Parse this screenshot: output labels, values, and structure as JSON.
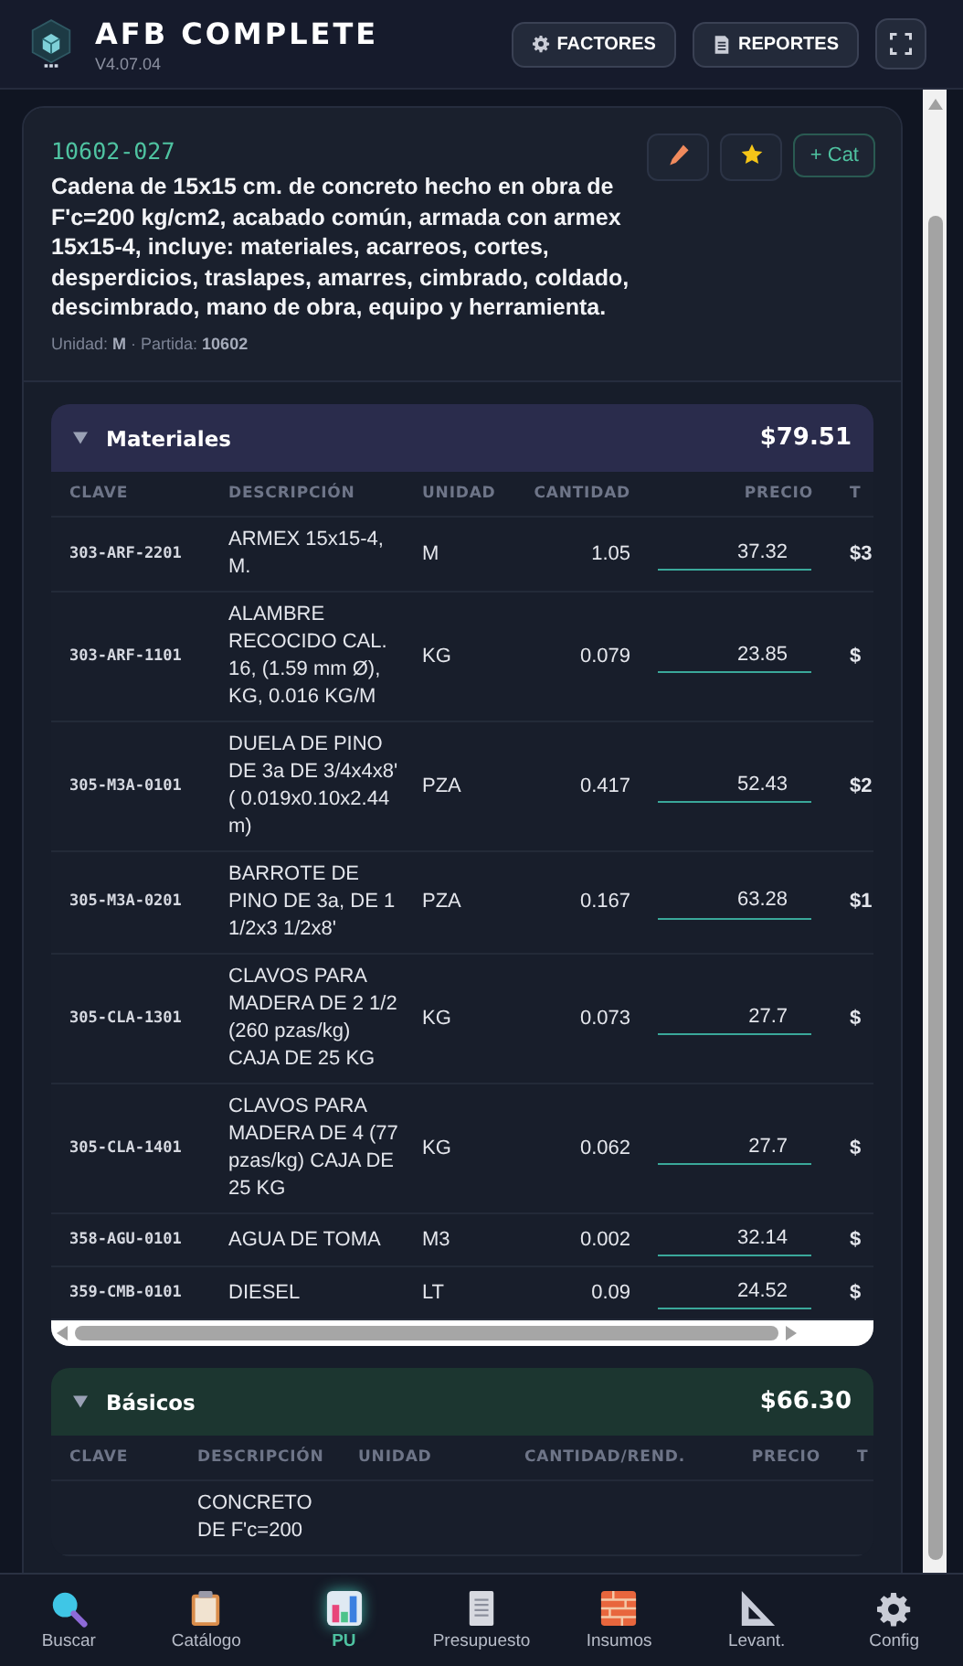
{
  "app": {
    "title": "AFB COMPLETE",
    "version": "V4.07.04"
  },
  "header_buttons": [
    {
      "kind": "gear",
      "label": "FACTORES"
    },
    {
      "kind": "doc",
      "label": "REPORTES"
    },
    {
      "kind": "fullscreen"
    }
  ],
  "item": {
    "code": "10602-027",
    "description": "Cadena de 15x15 cm. de concreto hecho en obra de F'c=200 kg/cm2, acabado común, armada con armex 15x15-4, incluye: materiales, acarreos, cortes, desperdicios, traslapes, amarres, cimbrado, coldado, descimbrado, mano de obra, equipo y herramienta.",
    "meta": "Unidad: **M** · Partida: **10602**",
    "actions": [
      {
        "kind": "edit"
      },
      {
        "kind": "favorite"
      },
      {
        "kind": "text",
        "label": "+ Cat"
      }
    ]
  },
  "sections": [
    {
      "kind": "materials",
      "title": "Materiales",
      "total": "$79.51",
      "expanded": true,
      "columns": [
        "CLAVE",
        "DESCRIPCIÓN",
        "UNIDAD",
        "CANTIDAD",
        "PRECIO",
        "T"
      ],
      "rows": [
        {
          "clave": "303-ARF-2201",
          "descripcion": "ARMEX 15x15-4, M.",
          "unidad": "M",
          "cantidad": "1.05",
          "precio": "37.32",
          "total": "$3"
        },
        {
          "clave": "303-ARF-1101",
          "descripcion": "ALAMBRE RECOCIDO CAL. 16, (1.59 mm Ø), KG, 0.016 KG/M",
          "unidad": "KG",
          "cantidad": "0.079",
          "precio": "23.85",
          "total": "$"
        },
        {
          "clave": "305-M3A-0101",
          "descripcion": "DUELA DE PINO DE 3a DE 3/4x4x8' ( 0.019x0.10x2.44 m)",
          "unidad": "PZA",
          "cantidad": "0.417",
          "precio": "52.43",
          "total": "$2"
        },
        {
          "clave": "305-M3A-0201",
          "descripcion": "BARROTE DE PINO DE 3a, DE 1 1/2x3 1/2x8'",
          "unidad": "PZA",
          "cantidad": "0.167",
          "precio": "63.28",
          "total": "$1"
        },
        {
          "clave": "305-CLA-1301",
          "descripcion": "CLAVOS PARA MADERA DE 2 1/2 (260 pzas/kg) CAJA DE 25 KG",
          "unidad": "KG",
          "cantidad": "0.073",
          "precio": "27.7",
          "total": "$"
        },
        {
          "clave": "305-CLA-1401",
          "descripcion": "CLAVOS PARA MADERA DE 4 (77 pzas/kg) CAJA DE 25 KG",
          "unidad": "KG",
          "cantidad": "0.062",
          "precio": "27.7",
          "total": "$"
        },
        {
          "clave": "358-AGU-0101",
          "descripcion": "AGUA DE TOMA",
          "unidad": "M3",
          "cantidad": "0.002",
          "precio": "32.14",
          "total": "$"
        },
        {
          "clave": "359-CMB-0101",
          "descripcion": "DIESEL",
          "unidad": "LT",
          "cantidad": "0.09",
          "precio": "24.52",
          "total": "$"
        }
      ]
    },
    {
      "kind": "basics",
      "title": "Básicos",
      "total": "$66.30",
      "expanded": true,
      "columns": [
        "CLAVE",
        "DESCRIPCIÓN",
        "UNIDAD",
        "CANTIDAD/REND.",
        "PRECIO",
        "T"
      ],
      "rows": [
        {
          "descripcion": "CONCRETO DE F'c=200"
        }
      ]
    }
  ],
  "nav": [
    {
      "kind": "search",
      "label": "Buscar",
      "selected": false
    },
    {
      "kind": "clipboard",
      "label": "Catálogo",
      "selected": false
    },
    {
      "kind": "chart",
      "label": "PU",
      "selected": true
    },
    {
      "kind": "sheet",
      "label": "Presupuesto",
      "selected": false
    },
    {
      "kind": "bricks",
      "label": "Insumos",
      "selected": false
    },
    {
      "kind": "triangle",
      "label": "Levant.",
      "selected": false
    },
    {
      "kind": "gear",
      "label": "Config",
      "selected": false
    }
  ]
}
